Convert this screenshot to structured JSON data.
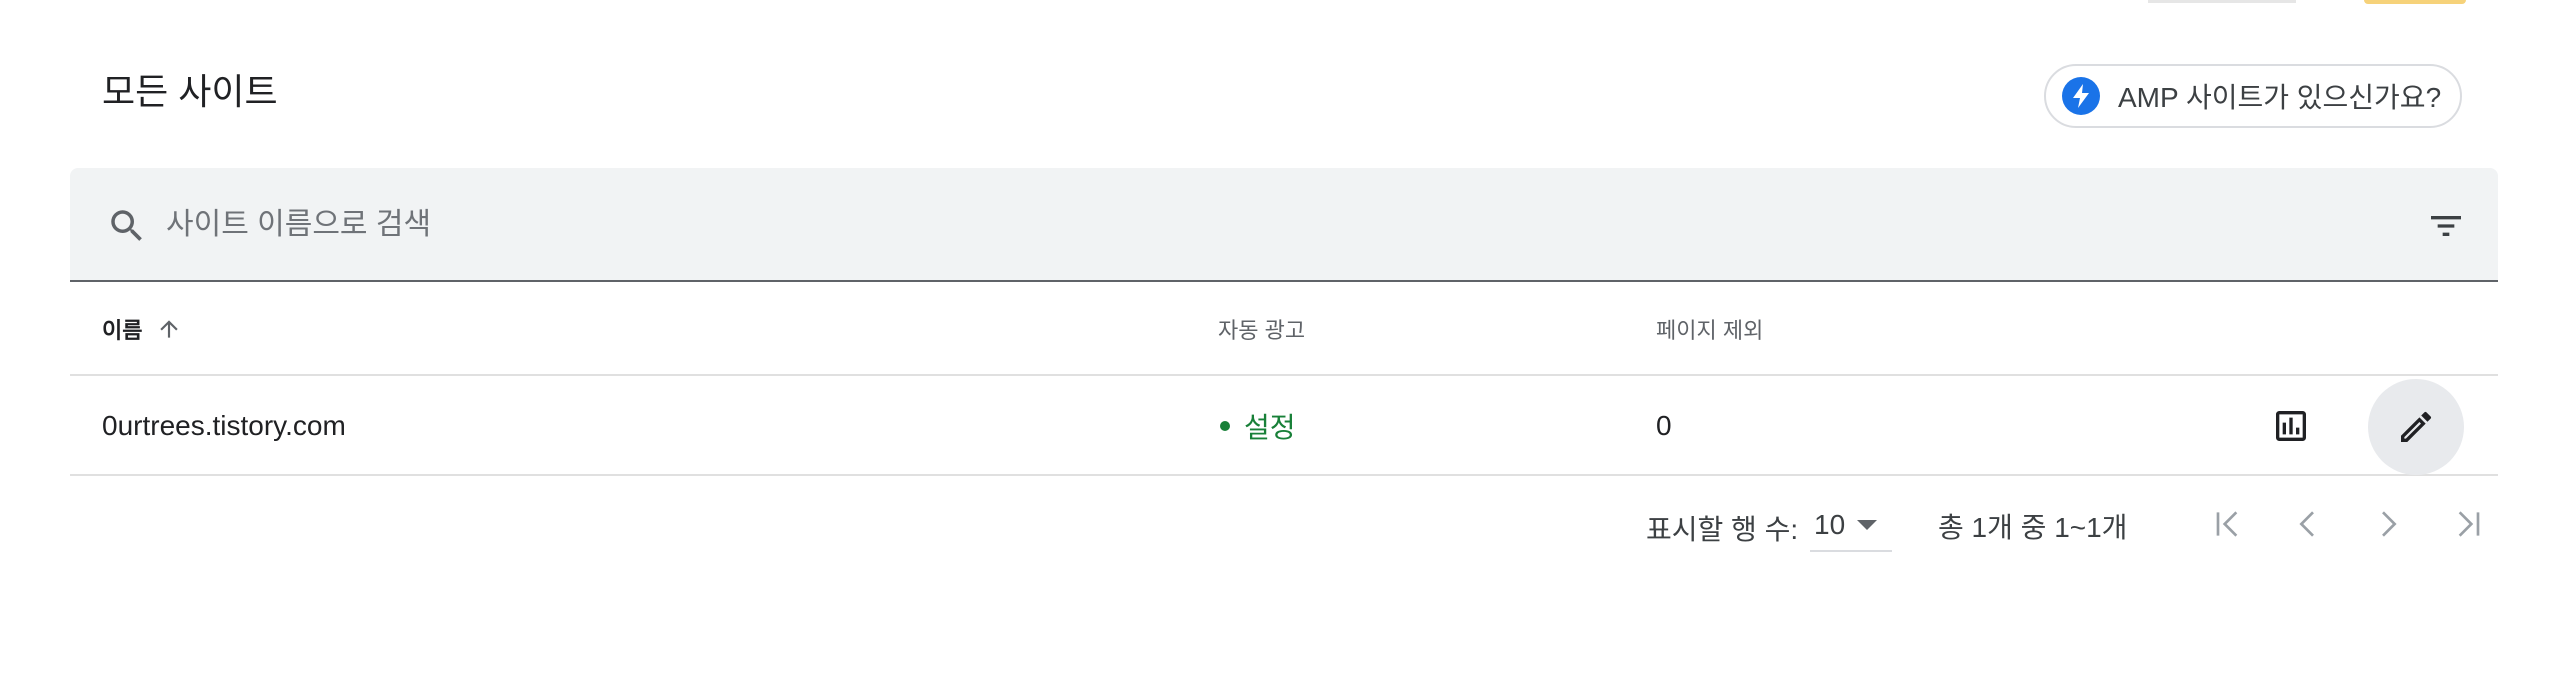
{
  "section": {
    "title": "모든 사이트"
  },
  "amp_button": {
    "label": "AMP 사이트가 있으신가요?",
    "icon": "bolt-icon"
  },
  "search": {
    "placeholder": "사이트 이름으로 검색",
    "value": ""
  },
  "table": {
    "columns": [
      {
        "label": "이름",
        "sort": "ascending"
      },
      {
        "label": "자동 광고"
      },
      {
        "label": "페이지 제외"
      }
    ],
    "rows": [
      {
        "name": "0urtrees.tistory.com",
        "auto_ads": "설정",
        "auto_ads_color": "#188038",
        "page_exclusions": "0"
      }
    ]
  },
  "pagination": {
    "rows_per_page_label": "표시할 행 수:",
    "rows_per_page": "10",
    "range_text": "총 1개 중 1~1개"
  },
  "colors": {
    "accent": "#1a73e8",
    "status_on": "#188038",
    "search_bg": "#f1f3f4",
    "edit_hover_bg": "#e8eaed"
  }
}
